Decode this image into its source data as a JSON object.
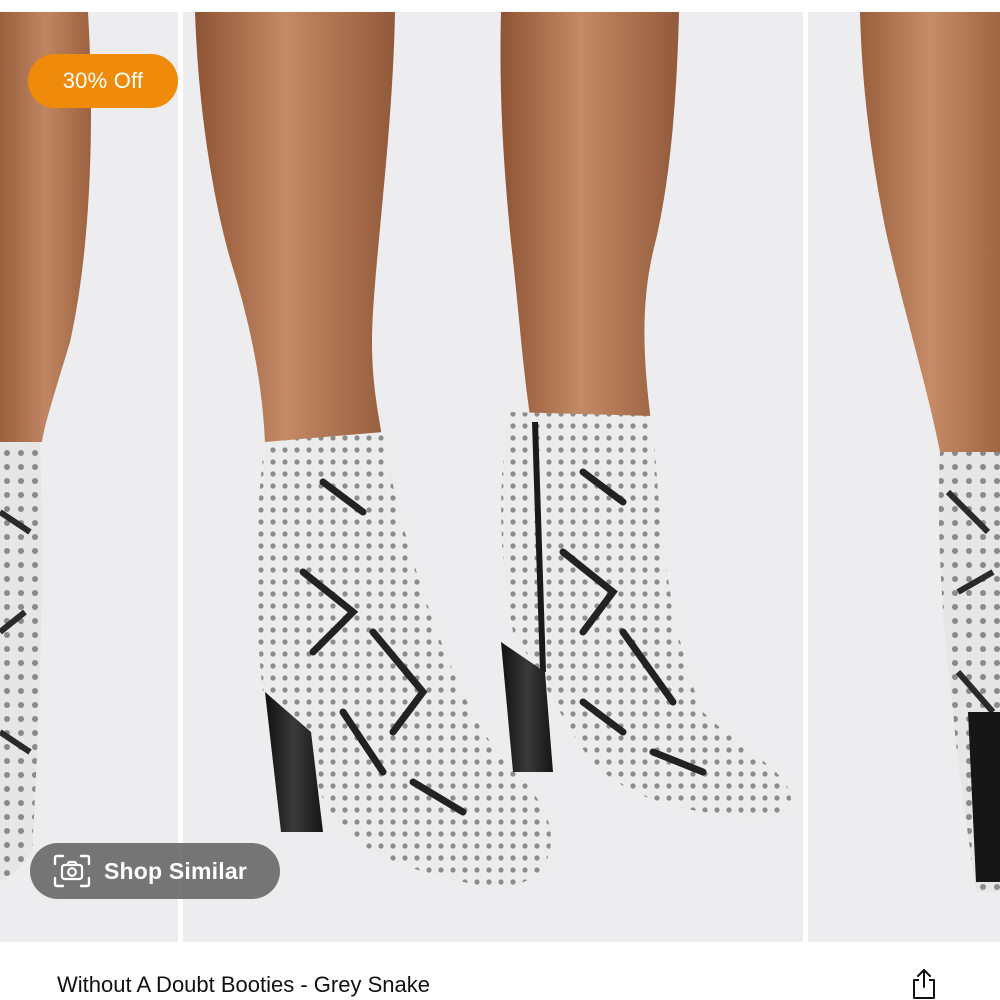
{
  "product": {
    "discount_label": "30% Off",
    "title": "Without A Doubt Booties - Grey Snake",
    "images": [
      {
        "alt": "product photo left",
        "icon": "product-image"
      },
      {
        "alt": "product photo main",
        "icon": "product-image"
      },
      {
        "alt": "product photo right",
        "icon": "product-image"
      }
    ]
  },
  "actions": {
    "shop_similar_label": "Shop Similar",
    "shop_similar_icon": "camera-icon",
    "share_icon": "share-icon"
  },
  "colors": {
    "badge": "#f08a0a",
    "overlay": "#5a5a5a",
    "background": "#ededef",
    "skin": "#b87a55",
    "boot": "#d8d8d8"
  }
}
